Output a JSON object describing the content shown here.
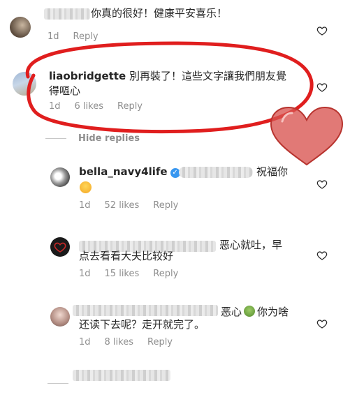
{
  "comments": [
    {
      "text": "你真的很好！健康平安喜乐！",
      "time": "1d",
      "reply": "Reply"
    },
    {
      "username": "liaobridgette",
      "text_line1": "別再裝了！這些文字讓我們朋友覺",
      "text_line2": "得嘔心",
      "time": "1d",
      "likes": "6 likes",
      "reply": "Reply"
    }
  ],
  "hide_replies": "Hide replies",
  "replies": [
    {
      "username": "bella_navy4life",
      "text": "祝福你",
      "time": "1d",
      "likes": "52 likes",
      "reply": "Reply"
    },
    {
      "text_line1": "恶心就吐，早",
      "text_line2": "点去看看大夫比较好",
      "time": "1d",
      "likes": "15 likes",
      "reply": "Reply"
    },
    {
      "text_line1a": "恶心",
      "text_line1b": "你为啥",
      "text_line2": "还读下去呢？走开就完了。",
      "time": "1d",
      "likes": "8 likes",
      "reply": "Reply"
    }
  ],
  "colors": {
    "annotation_red": "#e01e1e",
    "annotation_heart": "#d9534f",
    "meta_gray": "#8e8e8e"
  },
  "icons": [
    "heart-outline-icon",
    "verified-badge-icon",
    "nauseated-face-emoji",
    "smiling-face-emoji"
  ]
}
